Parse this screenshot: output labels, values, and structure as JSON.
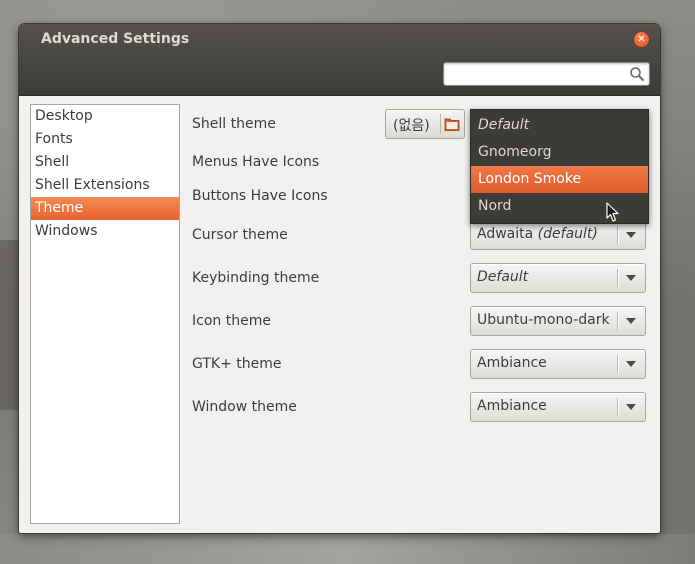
{
  "window": {
    "title": "Advanced Settings",
    "close_glyph": "✕"
  },
  "search": {
    "value": "",
    "placeholder": ""
  },
  "sidebar": {
    "items": [
      {
        "label": "Desktop"
      },
      {
        "label": "Fonts"
      },
      {
        "label": "Shell"
      },
      {
        "label": "Shell Extensions"
      },
      {
        "label": "Theme",
        "selected": true
      },
      {
        "label": "Windows"
      }
    ]
  },
  "theme": {
    "shell_theme": {
      "label": "Shell theme",
      "none_button": "(없음)"
    },
    "menus_have_icons": {
      "label": "Menus Have Icons"
    },
    "buttons_have_icons": {
      "label": "Buttons Have Icons"
    },
    "cursor_theme": {
      "label": "Cursor theme",
      "value": "Adwaita",
      "suffix": "(default)"
    },
    "keybinding_theme": {
      "label": "Keybinding theme",
      "value": "Default"
    },
    "icon_theme": {
      "label": "Icon theme",
      "value": "Ubuntu-mono-dark"
    },
    "gtk_theme": {
      "label": "GTK+ theme",
      "value": "Ambiance"
    },
    "window_theme": {
      "label": "Window theme",
      "value": "Ambiance"
    }
  },
  "shell_dropdown": {
    "options": [
      {
        "label": "Default"
      },
      {
        "label": "Gnomeorg"
      },
      {
        "label": "London Smoke",
        "highlighted": true
      },
      {
        "label": "Nord"
      }
    ]
  },
  "colors": {
    "accent": "#e8632f",
    "titlebar": "#4a4843",
    "menu_bg": "#3c3b37"
  }
}
